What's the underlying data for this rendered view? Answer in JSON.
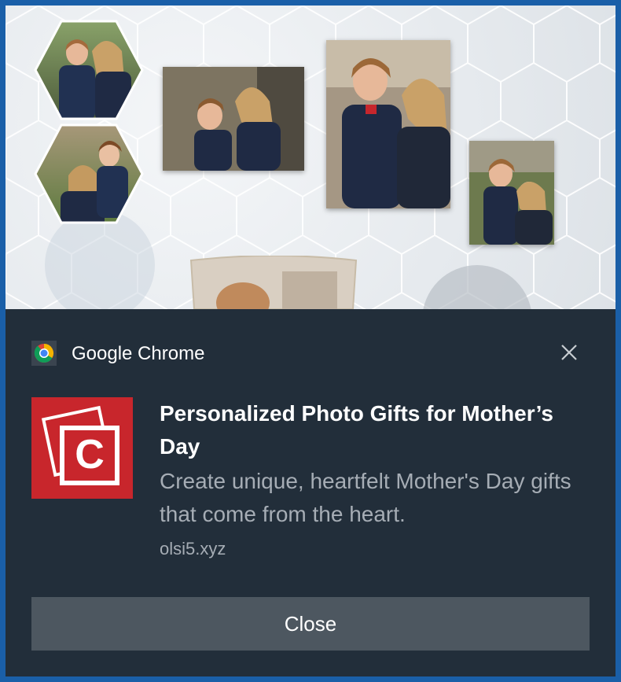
{
  "hero": {
    "image_alt": "Collage of photos of a mother and child on a hexagon-pattern background"
  },
  "notification": {
    "app_name": "Google Chrome",
    "title": "Personalized Photo Gifts for Mother’s Day",
    "body": "Create unique, heartfelt Mother's Day gifts that come from the heart.",
    "domain": "olsi5.xyz",
    "close_button_label": "Close",
    "logo_letter": "C"
  },
  "colors": {
    "frame_border": "#1a5fa8",
    "notification_bg": "#222e3a",
    "button_bg": "#4d5760",
    "logo_bg": "#c8262c",
    "secondary_text": "#a6adb5"
  },
  "icons": {
    "app": "chrome-icon",
    "dismiss": "close-icon",
    "logo": "photo-gift-logo-icon"
  }
}
